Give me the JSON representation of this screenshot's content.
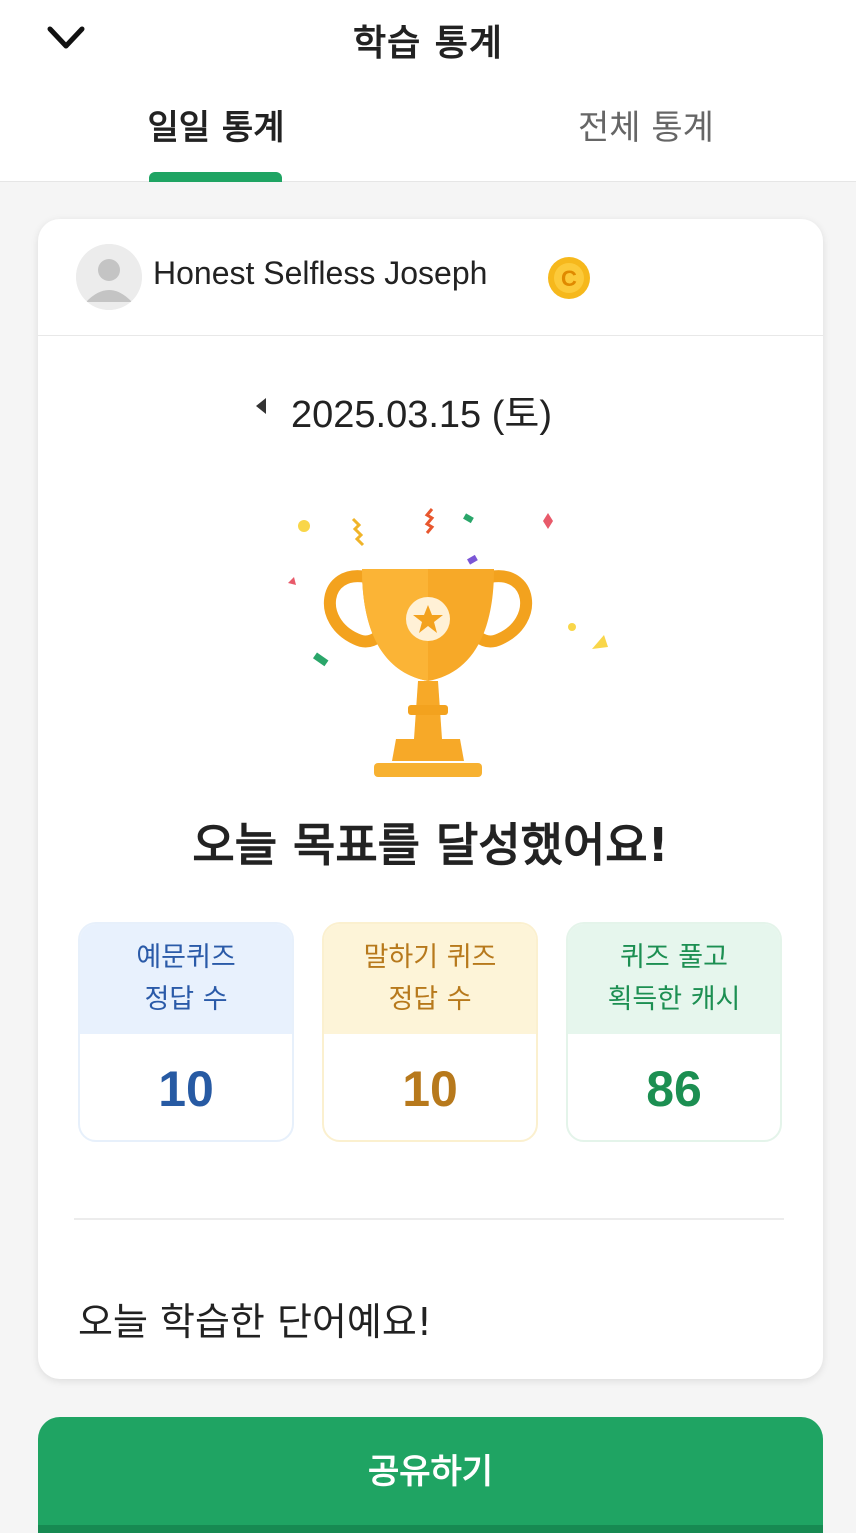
{
  "header": {
    "title": "학습 통계",
    "tabs": [
      {
        "label": "일일 통계",
        "active": true
      },
      {
        "label": "전체 통계",
        "active": false
      }
    ]
  },
  "user": {
    "name": "Honest Selfless Joseph",
    "coin_icon": "coin-icon"
  },
  "date": {
    "label": "2025.03.15 (토)"
  },
  "goal": {
    "message": "오늘 목표를 달성했어요!"
  },
  "stats": [
    {
      "line1": "예문퀴즈",
      "line2": "정답 수",
      "value": "10",
      "color": "#275aa3"
    },
    {
      "line1": "말하기 퀴즈",
      "line2": "정답 수",
      "value": "10",
      "color": "#b7791c"
    },
    {
      "line1": "퀴즈 풀고",
      "line2": "획득한 캐시",
      "value": "86",
      "color": "#1c8f52"
    }
  ],
  "words_section": {
    "title": "오늘 학습한 단어예요!"
  },
  "share": {
    "label": "공유하기"
  },
  "colors": {
    "accent": "#1fa463",
    "background": "#f5f5f5",
    "trophy": "#f7a928"
  }
}
